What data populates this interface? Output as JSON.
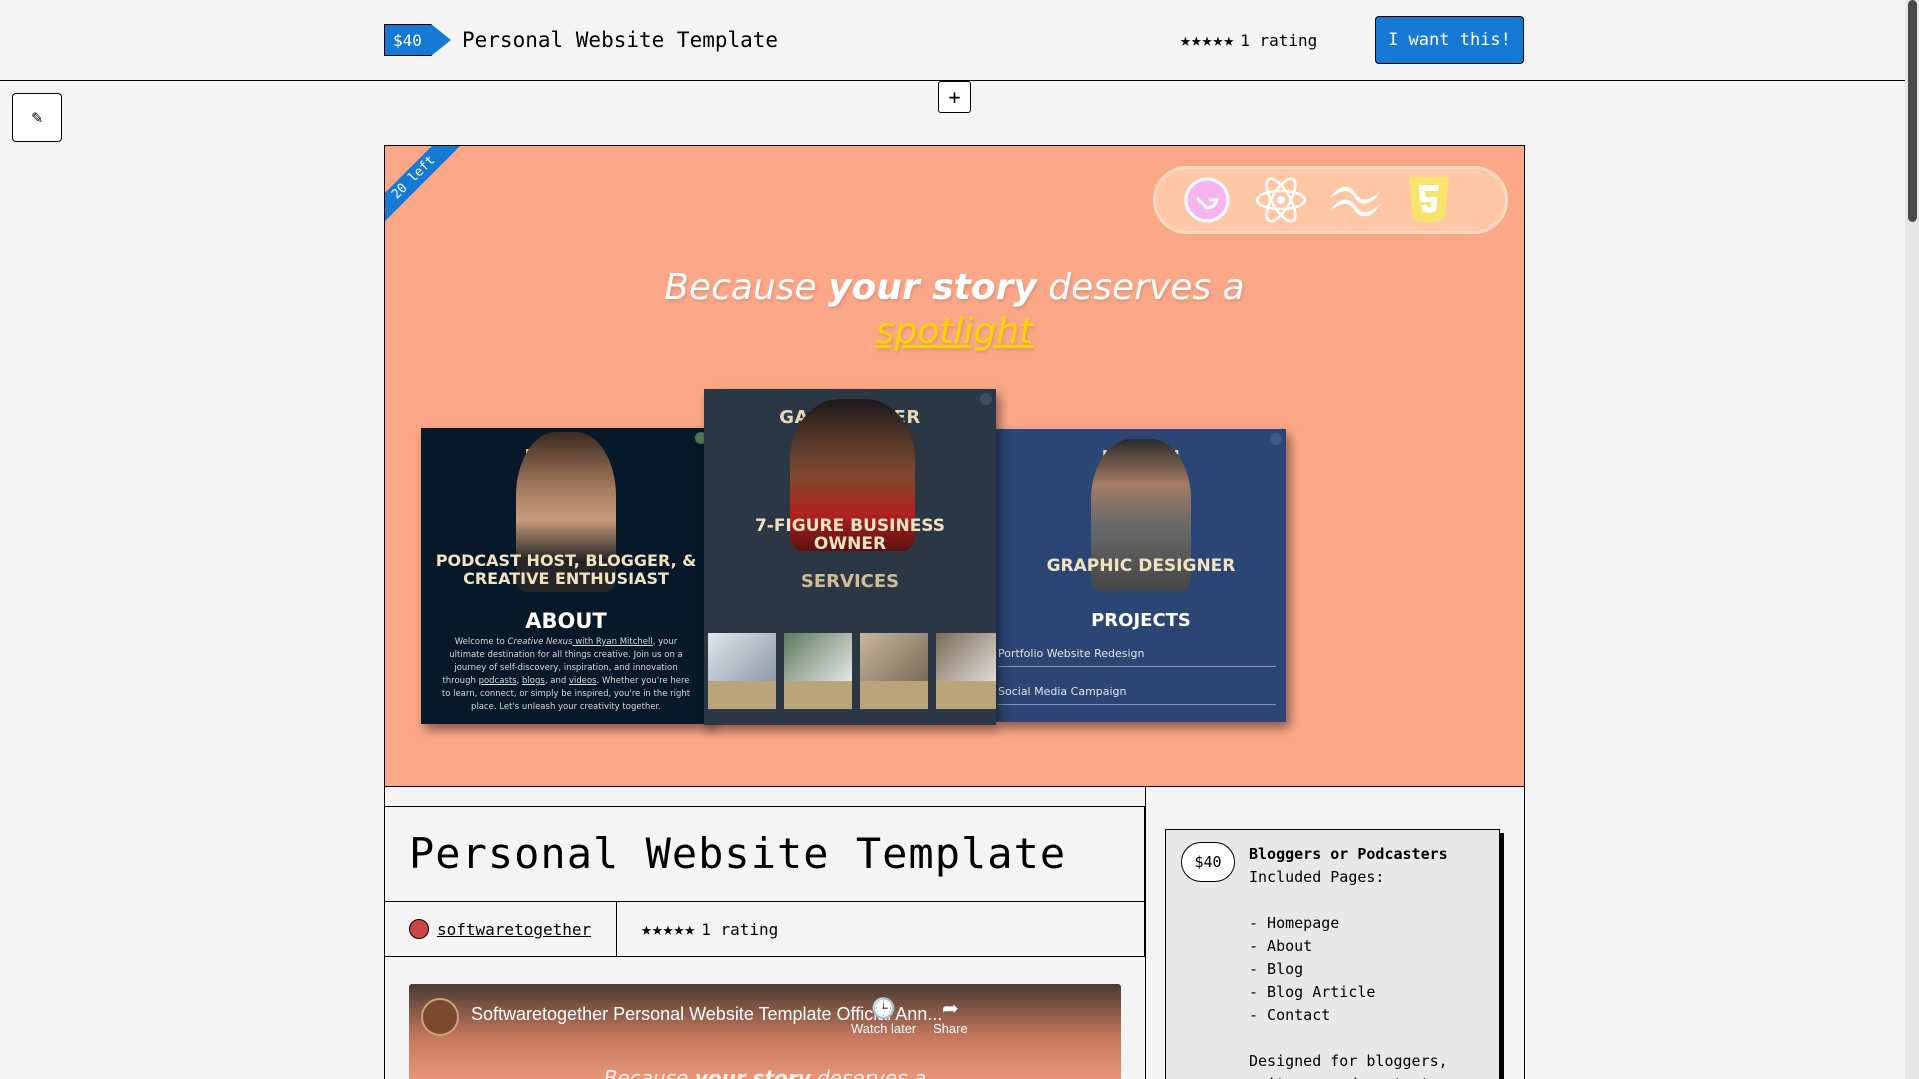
{
  "header": {
    "price": "$40",
    "title": "Personal Website Template",
    "rating_stars": "★★★★★",
    "rating_text": "1 rating",
    "cta_label": "I want this!"
  },
  "toolbar": {
    "plus_label": "+",
    "edit_icon": "pencil-icon",
    "edit_glyph": "✎"
  },
  "hero": {
    "ribbon": "20 left",
    "tech_icons": [
      "gatsby-icon",
      "react-icon",
      "tailwind-icon",
      "html5-icon"
    ],
    "headline_part1": "Because ",
    "headline_bold": "your story",
    "headline_part2": " deserves a",
    "headline_highlight": "spotlight",
    "shot1": {
      "name": "RYA                ELL",
      "role": "PODCAST HOST, BLOGGER, & CREATIVE ENTHUSIAST",
      "section": "ABOUT",
      "para_prefix": "Welcome to ",
      "para_italic": "Creative Nexus",
      "para_link": " with Ryan Mitchell",
      "para_body": ", your ultimate destination for all things creative. Join us on a journey of self-discovery, inspiration, and innovation through ",
      "para_link2": "podcasts",
      "para_sep1": ", ",
      "para_link3": "blogs",
      "para_sep2": ", and ",
      "para_link4": "videos",
      "para_end": ". Whether you're here to learn, connect, or simply be inspired, you're in the right place. Let's unleash your creativity together."
    },
    "shot2": {
      "name": "GABRI          OSTER",
      "role": "7-FIGURE BUSINESS OWNER",
      "section": "SERVICES"
    },
    "shot3": {
      "name": "JOS         ITH",
      "role": "GRAPHIC DESIGNER",
      "section": "PROJECTS",
      "projects": [
        "Portfolio Website Redesign",
        "Social Media Campaign"
      ]
    }
  },
  "product": {
    "title": "Personal Website Template",
    "author": "softwaretogether",
    "rating_stars": "★★★★★",
    "rating_text": "1 rating"
  },
  "video": {
    "title": "Softwaretogether Personal Website Template Official Ann...",
    "watch_later": "Watch later",
    "share": "Share",
    "preview_part1": "Because ",
    "preview_bold": "your story",
    "preview_part2": " deserves a"
  },
  "sidebar": {
    "price": "$40",
    "heading": "Bloggers or Podcasters",
    "body": "Included Pages:\n\n- Homepage\n- About\n- Blog\n- Blog Article\n- Contact\n\nDesigned for bloggers,\nwriters, and content"
  },
  "colors": {
    "accent": "#1679d4",
    "hero_bg": "#fca888",
    "highlight": "#ffd500"
  }
}
